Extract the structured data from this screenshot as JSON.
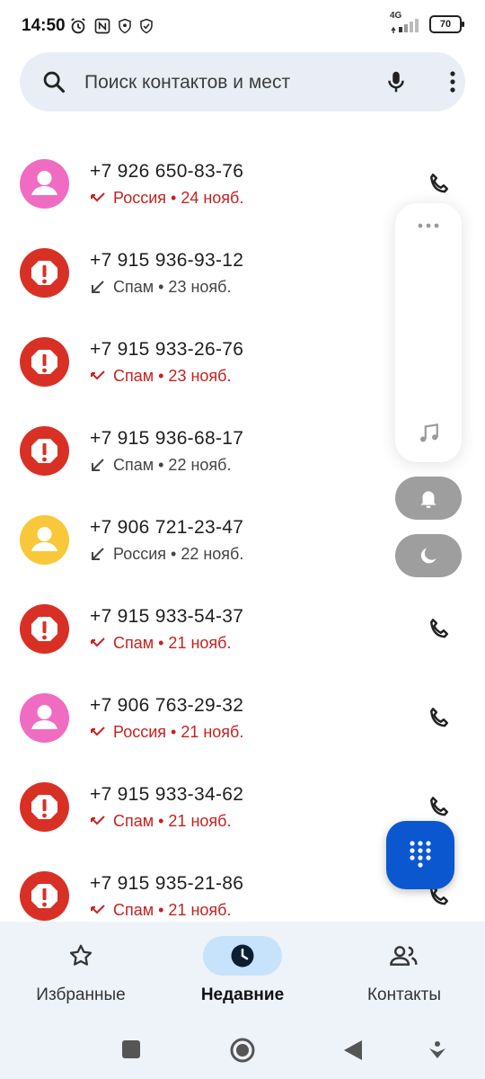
{
  "status_bar": {
    "time": "14:50",
    "network": "4G",
    "battery": "70",
    "icons": [
      "alarm-icon",
      "nfc-icon",
      "shield-icon",
      "shield-check-icon",
      "signal-icon",
      "battery-icon"
    ]
  },
  "search": {
    "placeholder": "Поиск контактов и мест",
    "icons": [
      "search-icon",
      "mic-icon",
      "more-vert-icon"
    ]
  },
  "calls": [
    {
      "number": "+7 926 650-83-76",
      "meta": "Россия • 24 нояб.",
      "type": "missed",
      "avatar": "person-pink"
    },
    {
      "number": "+7 915 936-93-12",
      "meta": "Спам • 23 нояб.",
      "type": "incoming",
      "avatar": "spam"
    },
    {
      "number": "+7 915 933-26-76",
      "meta": "Спам • 23 нояб.",
      "type": "missed",
      "avatar": "spam"
    },
    {
      "number": "+7 915 936-68-17",
      "meta": "Спам • 22 нояб.",
      "type": "incoming",
      "avatar": "spam"
    },
    {
      "number": "+7 906 721-23-47",
      "meta": "Россия • 22 нояб.",
      "type": "incoming",
      "avatar": "person-yellow"
    },
    {
      "number": "+7 915 933-54-37",
      "meta": "Спам • 21 нояб.",
      "type": "missed",
      "avatar": "spam"
    },
    {
      "number": "+7 906 763-29-32",
      "meta": "Россия • 21 нояб.",
      "type": "missed",
      "avatar": "person-pink"
    },
    {
      "number": "+7 915 933-34-62",
      "meta": "Спам • 21 нояб.",
      "type": "missed",
      "avatar": "spam"
    },
    {
      "number": "+7 915 935-21-86",
      "meta": "Спам • 21 нояб.",
      "type": "missed",
      "avatar": "spam"
    }
  ],
  "quick_panel": {
    "icons": [
      "more-horiz-icon",
      "music-note-icon",
      "bell-icon",
      "moon-icon"
    ]
  },
  "fab": {
    "icon": "dialpad-icon"
  },
  "bottom_nav": {
    "items": [
      {
        "label": "Избранные",
        "icon": "star-icon",
        "active": false
      },
      {
        "label": "Недавние",
        "icon": "clock-icon",
        "active": true
      },
      {
        "label": "Контакты",
        "icon": "people-icon",
        "active": false
      }
    ]
  },
  "system_nav": {
    "icons": [
      "recents-square-icon",
      "home-circle-icon",
      "back-triangle-icon",
      "assistant-icon"
    ]
  },
  "colors": {
    "missed": "#c5221f",
    "spam_avatar": "#d93025",
    "pink_avatar": "#f06cc3",
    "yellow_avatar": "#f8c83a",
    "fab": "#0b57d0",
    "nav_active": "#c7e3fb",
    "search_bg": "#e9eef6"
  }
}
